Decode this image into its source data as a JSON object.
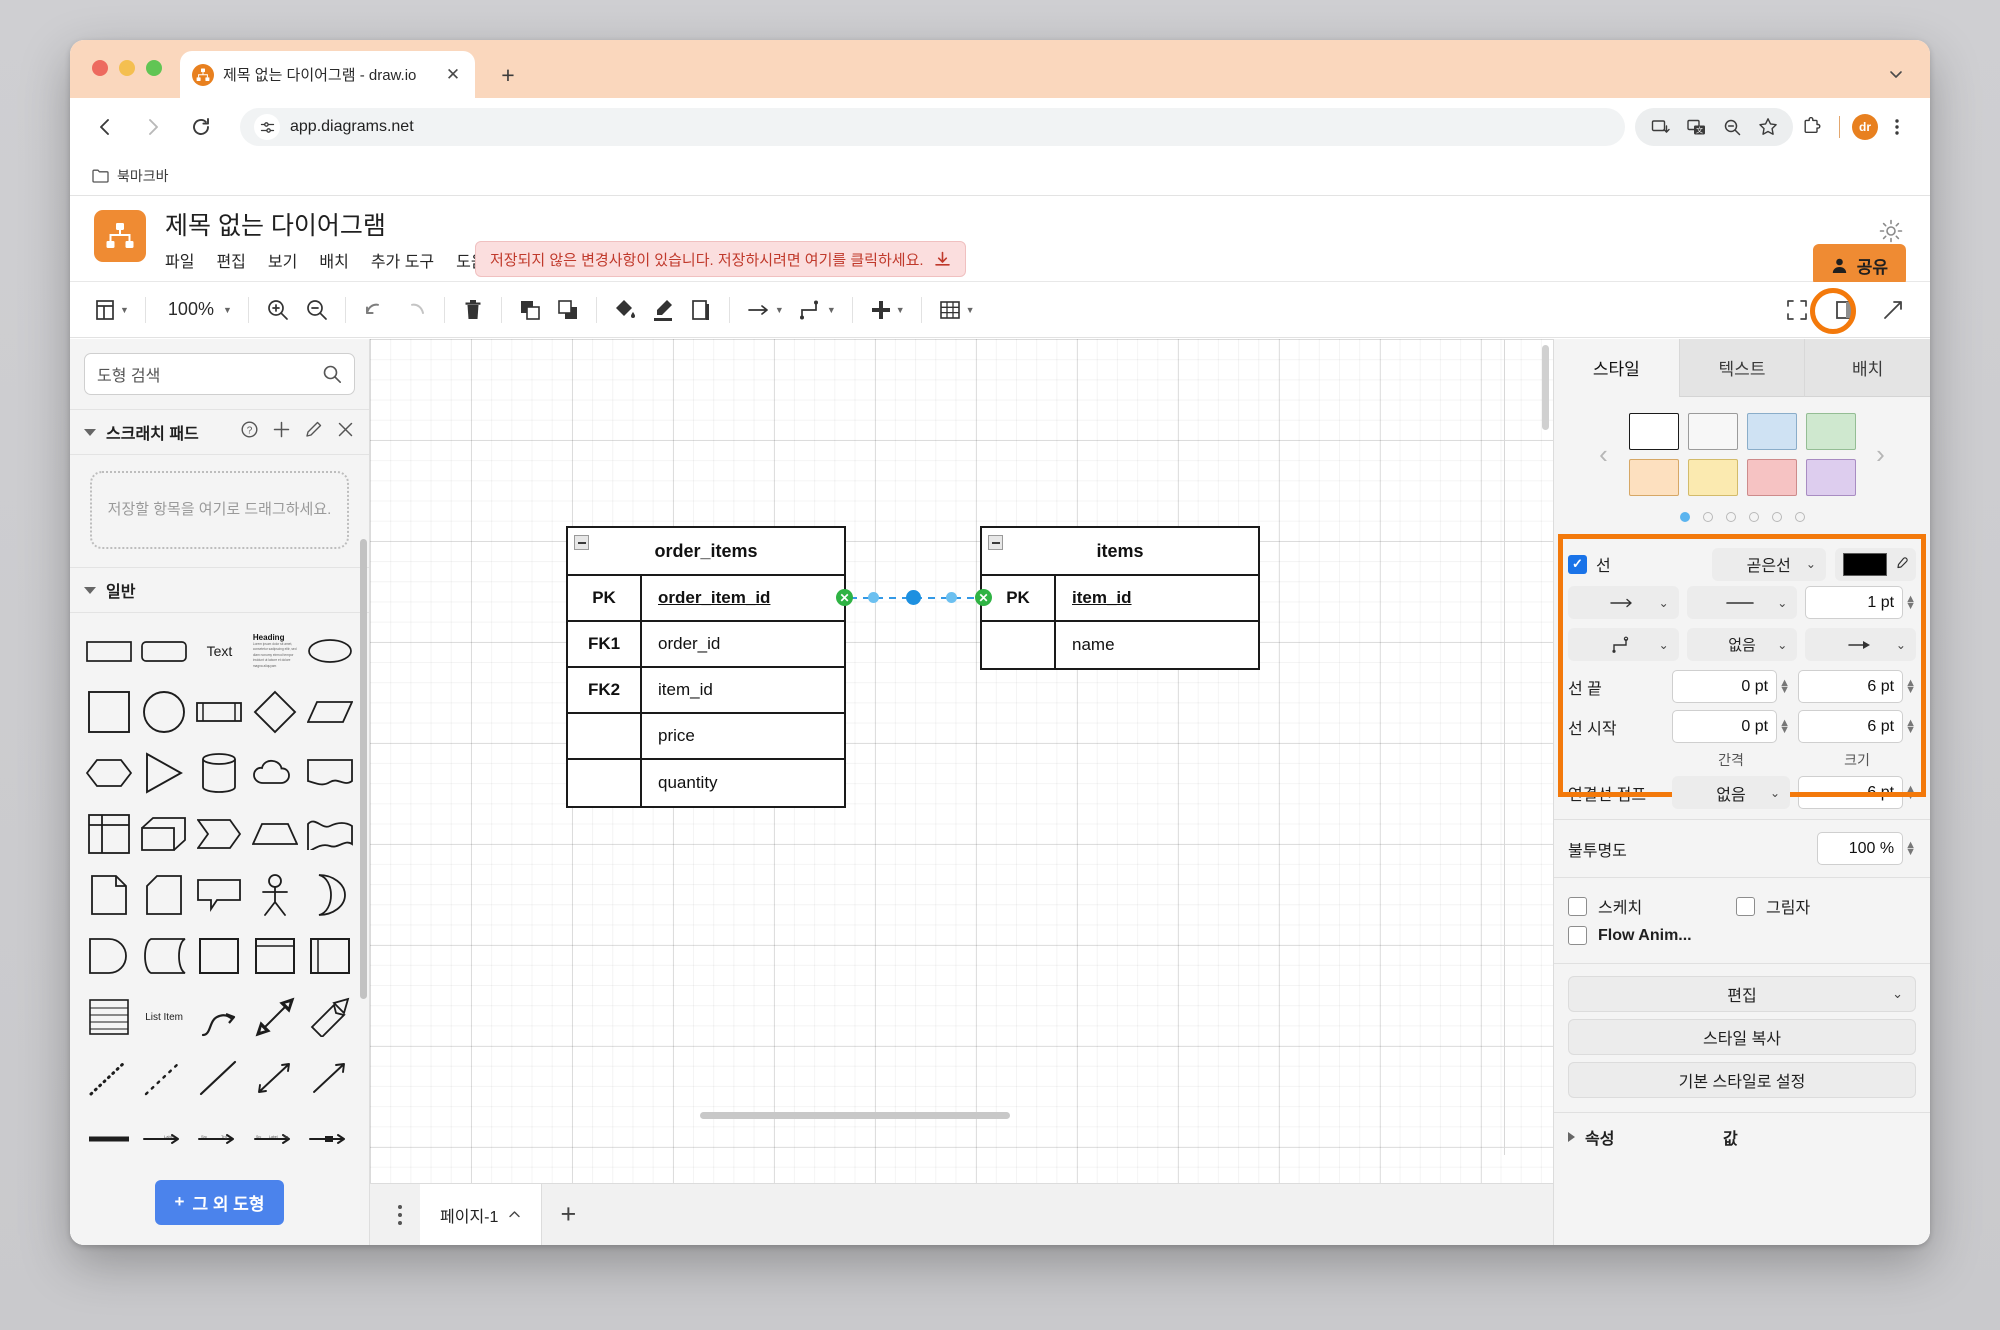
{
  "browser": {
    "tab": {
      "title": "제목 없는 다이어그램 - draw.io",
      "favicon": "drawio-icon",
      "close": "close-icon"
    },
    "newtab_label": "+",
    "tab_list_chevron": "chevron-down-icon",
    "nav": {
      "back": "back-arrow-icon",
      "forward": "forward-arrow-icon",
      "reload": "reload-icon"
    },
    "omnibox": {
      "url": "app.diagrams.net",
      "site_info": "site-settings-icon"
    },
    "actions": {
      "install": "install-icon",
      "translate": "translate-icon",
      "zoom": "zoom-icon",
      "bookmark": "star-icon",
      "extensions": "extensions-icon",
      "profile": "dr",
      "menu": "three-dot-menu-icon"
    },
    "bookmarks": {
      "folder_label": "북마크바",
      "folder_icon": "folder-icon"
    }
  },
  "app": {
    "doc_title": "제목 없는 다이어그램",
    "menus": [
      "파일",
      "편집",
      "보기",
      "배치",
      "추가 도구",
      "도움말"
    ],
    "unsaved_notice": "저장되지 않은 변경사항이 있습니다. 저장하시려면 여기를 클릭하세요.",
    "unsaved_icon": "download-icon",
    "share_label": "공유",
    "theme_toggle": "sun-icon",
    "accent_orange": "#ef8b33",
    "highlight_orange": "#f3790b"
  },
  "toolbar": {
    "view_label": "view-dropdown",
    "zoom_level": "100%",
    "items": [
      "view-icon",
      "zoom-in-icon",
      "zoom-out-icon",
      "undo-icon",
      "redo-icon",
      "delete-icon",
      "to-front-icon",
      "to-back-icon",
      "fill-color-icon",
      "line-color-icon",
      "shadow-icon",
      "connection-arrow-icon",
      "waypoints-icon",
      "insert-icon",
      "table-icon"
    ],
    "right_items": [
      "fullscreen-icon",
      "format-panel-icon",
      "collapse-icon"
    ]
  },
  "left_panel": {
    "search_placeholder": "도형 검색",
    "search_icon": "search-icon",
    "scratchpad": {
      "title": "스크래치 패드",
      "icons": [
        "help-icon",
        "add-icon",
        "edit-icon",
        "close-icon"
      ],
      "drop_hint": "저장할 항목을 여기로 드래그하세요."
    },
    "general_title": "일반",
    "shape_labels": [
      "Text",
      "Heading",
      "List Item"
    ],
    "more_shapes_label": "그 외 도형"
  },
  "canvas": {
    "tables": [
      {
        "name": "order_items",
        "rows": [
          {
            "key": "PK",
            "column": "order_item_id",
            "primary": true
          },
          {
            "key": "FK1",
            "column": "order_id",
            "primary": false
          },
          {
            "key": "FK2",
            "column": "item_id",
            "primary": false
          },
          {
            "key": "",
            "column": "price",
            "primary": false
          },
          {
            "key": "",
            "column": "quantity",
            "primary": false
          }
        ]
      },
      {
        "name": "items",
        "rows": [
          {
            "key": "PK",
            "column": "item_id",
            "primary": true
          },
          {
            "key": "",
            "column": "name",
            "primary": false
          }
        ]
      }
    ],
    "edge_selected": true,
    "page_tab": "페이지-1",
    "page_tab_chevron": "chevron-up-icon",
    "add_page": "+",
    "page_menu": "kebab-menu-icon"
  },
  "right_panel": {
    "tabs": [
      {
        "label": "스타일",
        "active": true
      },
      {
        "label": "텍스트",
        "active": false
      },
      {
        "label": "배치",
        "active": false
      }
    ],
    "swatches": [
      "#ffffff",
      "#f7f7f7",
      "#cfe2f3",
      "#cfe8cf",
      "#fde0bf",
      "#fbeab0",
      "#f6c3c3",
      "#ddcdee"
    ],
    "swatch_pages": 6,
    "swatch_page_active": 1,
    "prev_icon": "chevron-left-icon",
    "next_icon": "chevron-right-icon",
    "line": {
      "enabled": true,
      "label": "선",
      "style_value": "곧은선",
      "color": "#000000",
      "picker_icon": "eyedropper-icon",
      "start_arrow_icon": "arrow-right-icon",
      "dash_style_icon": "solid-line-icon",
      "width_value": "1 pt",
      "waypoint_icon": "orthogonal-waypoint-icon",
      "start_arrow_value": "없음",
      "end_arrow_icon": "arrow-right-filled-icon",
      "end_label": "선 끝",
      "end_spacing": "0 pt",
      "end_size": "6 pt",
      "start_label": "선 시작",
      "start_spacing": "0 pt",
      "start_size": "6 pt",
      "col_spacing_label": "간격",
      "col_size_label": "크기",
      "jump_label": "연결선 점프",
      "jump_value": "없음",
      "jump_size": "6 pt"
    },
    "opacity": {
      "label": "불투명도",
      "value": "100 %"
    },
    "checkboxes": [
      {
        "label": "스케치",
        "checked": false
      },
      {
        "label": "그림자",
        "checked": false
      },
      {
        "label": "Flow Anim...",
        "checked": false
      }
    ],
    "buttons": [
      {
        "label": "편집",
        "has_chevron": true
      },
      {
        "label": "스타일 복사",
        "has_chevron": false
      },
      {
        "label": "기본 스타일로 설정",
        "has_chevron": false
      }
    ],
    "properties": {
      "name_header": "속성",
      "value_header": "값",
      "expander": "triangle-right-icon"
    }
  }
}
